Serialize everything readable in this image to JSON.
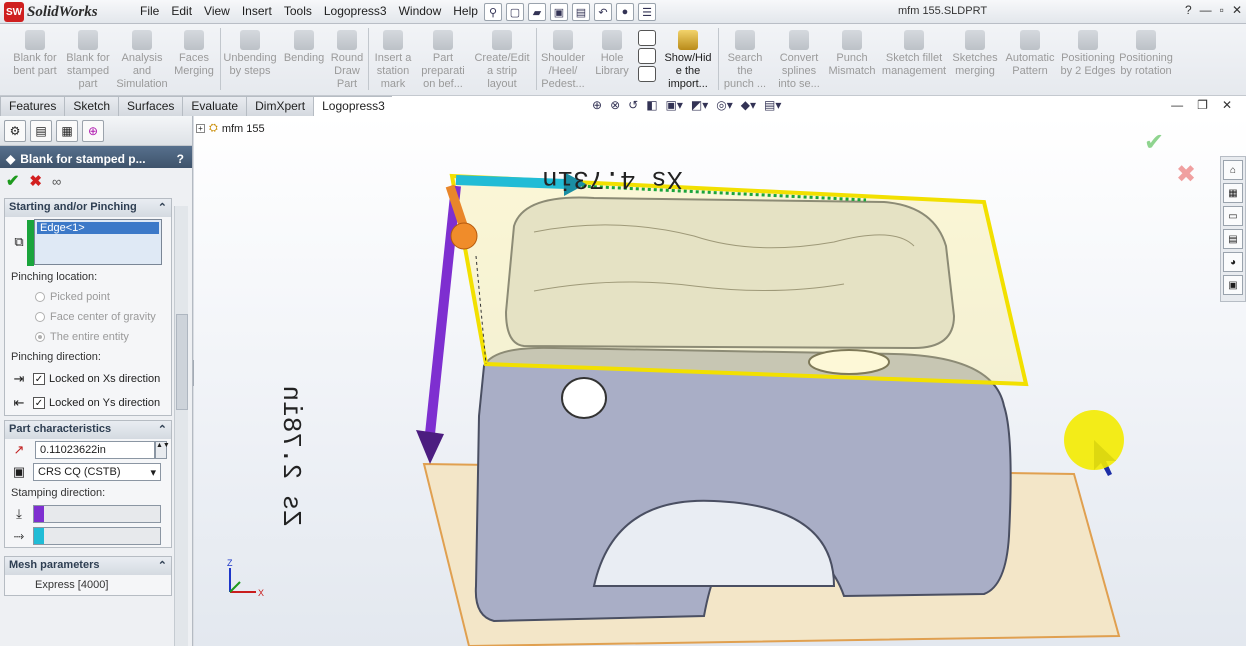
{
  "app": {
    "logo_badge": "SW",
    "logo_text": "SolidWorks",
    "document_title": "mfm 155.SLDPRT"
  },
  "menu": [
    "File",
    "Edit",
    "View",
    "Insert",
    "Tools",
    "Logopress3",
    "Window",
    "Help"
  ],
  "window_controls": {
    "help": "?",
    "minimize": "—",
    "restore": "▫",
    "close": "✕"
  },
  "ribbon": [
    {
      "label": "Blank for bent part",
      "enabled": false
    },
    {
      "label": "Blank for stamped part",
      "enabled": false
    },
    {
      "label": "Analysis and Simulation",
      "enabled": false
    },
    {
      "label": "Faces Merging",
      "enabled": false
    },
    {
      "label": "Unbending by steps",
      "enabled": false
    },
    {
      "label": "Bending",
      "enabled": false
    },
    {
      "label": "Round Draw Part",
      "enabled": false
    },
    {
      "label": "Insert a station mark",
      "enabled": false
    },
    {
      "label": "Part preparati on bef...",
      "enabled": false
    },
    {
      "label": "Create/Edit a strip layout",
      "enabled": false
    },
    {
      "label": "Shoulder /Heel/ Pedest...",
      "enabled": false
    },
    {
      "label": "Hole Library",
      "enabled": false
    },
    {
      "label": "Show/Hid e the import...",
      "enabled": true
    },
    {
      "label": "Search the punch ...",
      "enabled": false
    },
    {
      "label": "Convert splines into se...",
      "enabled": false
    },
    {
      "label": "Punch Mismatch",
      "enabled": false
    },
    {
      "label": "Sketch fillet management",
      "enabled": false
    },
    {
      "label": "Sketches merging",
      "enabled": false
    },
    {
      "label": "Automatic Pattern",
      "enabled": false
    },
    {
      "label": "Positioning by 2 Edges",
      "enabled": false
    },
    {
      "label": "Positioning by rotation",
      "enabled": false
    }
  ],
  "tabs": [
    {
      "label": "Features",
      "active": false
    },
    {
      "label": "Sketch",
      "active": false
    },
    {
      "label": "Surfaces",
      "active": false
    },
    {
      "label": "Evaluate",
      "active": false
    },
    {
      "label": "DimXpert",
      "active": false
    },
    {
      "label": "Logopress3",
      "active": true
    }
  ],
  "property_manager": {
    "title": "Blank for stamped p...",
    "help": "?",
    "starting_group": {
      "title": "Starting and/or Pinching",
      "selected_entity": "Edge<1>",
      "pinching_location_label": "Pinching location:",
      "pinching_options": [
        {
          "label": "Picked point",
          "checked": false
        },
        {
          "label": "Face center of gravity",
          "checked": false
        },
        {
          "label": "The entire entity",
          "checked": true
        }
      ],
      "pinching_direction_label": "Pinching direction:",
      "lock_xs_label": "Locked on Xs direction",
      "lock_ys_label": "Locked on Ys direction"
    },
    "part_group": {
      "title": "Part characteristics",
      "thickness": "0.11023622in",
      "material": "CRS CQ (CSTB)",
      "stamping_label": "Stamping direction:"
    },
    "mesh_group": {
      "title": "Mesh parameters",
      "value": "Express [4000]"
    }
  },
  "graphics": {
    "tree_root": "mfm 155",
    "dim_xs": "Xs 4.73in",
    "dim_zs": "Zs 2.78in",
    "triad_z": "Z",
    "triad_x": "X"
  },
  "colors": {
    "accent": "#57708d",
    "zs_arrow": "#7e2fd0",
    "xs_arrow": "#21bcd6",
    "blank_outline": "#f2e000"
  }
}
